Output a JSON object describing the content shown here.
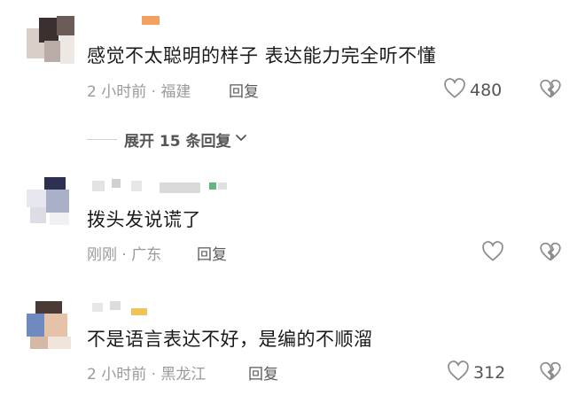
{
  "comments": [
    {
      "text": "感觉不太聪明的样子  表达能力完全听不懂",
      "meta": "2 小时前 · 福建",
      "reply_label": "回复",
      "like_count": "480",
      "expand_label": "展开 15 条回复"
    },
    {
      "text": "拨头发说谎了",
      "meta": "刚刚 · 广东",
      "reply_label": "回复",
      "like_count": ""
    },
    {
      "text": "不是语言表达不好，是编的不顺溜",
      "meta": "2 小时前 · 黑龙江",
      "reply_label": "回复",
      "like_count": "312"
    }
  ],
  "icons": {
    "like": "heart-outline-icon",
    "dislike": "broken-heart-icon",
    "expand": "chevron-down-icon"
  },
  "colors": {
    "text": "#1a1a1a",
    "meta": "#9a9a9a",
    "icon": "#8c8c8c"
  }
}
